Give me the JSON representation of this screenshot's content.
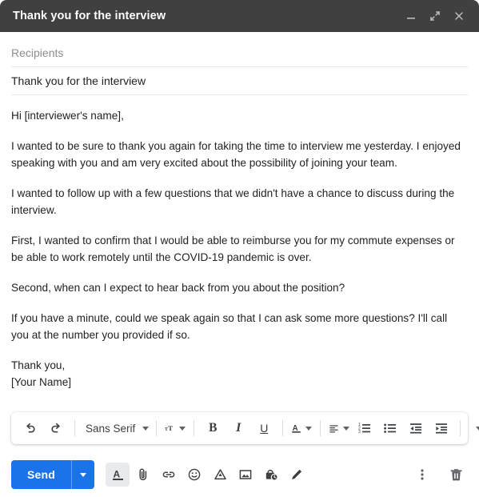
{
  "window": {
    "title": "Thank you for the interview",
    "header_color": "#404040",
    "controls": [
      {
        "name": "minimize",
        "label": "Minimize"
      },
      {
        "name": "expand",
        "label": "Full screen"
      },
      {
        "name": "close",
        "label": "Save & close"
      }
    ]
  },
  "fields": {
    "recipients_placeholder": "Recipients",
    "recipients_value": "",
    "subject_value": "Thank you for the interview"
  },
  "body": {
    "paragraphs": [
      "Hi [interviewer's name],",
      "I wanted to be sure to thank you again for taking the time to interview me yesterday. I enjoyed speaking with you and am very excited about the possibility of joining your team.",
      "I wanted to follow up with a few questions that we didn't have a chance to discuss during the interview.",
      "First, I wanted to confirm that I would be able to reimburse you for my commute expenses or be able to work remotely until the COVID-19 pandemic is over.",
      "Second, when can I expect to hear back from you about the position?",
      "If you have a minute, could we speak again so that I can ask some more questions? I'll call you at the number you provided if so."
    ],
    "signoff": "Thank you,",
    "signature": "[Your Name]"
  },
  "format_toolbar": {
    "undo_label": "Undo",
    "redo_label": "Redo",
    "font_family": "Sans Serif",
    "font_size_label": "Size",
    "bold_label": "B",
    "italic_label": "I",
    "underline_label": "U",
    "text_color_label": "A",
    "align_label": "Align",
    "numbered_list_label": "Numbered list",
    "bulleted_list_label": "Bulleted list",
    "indent_less_label": "Indent less",
    "indent_more_label": "Indent more",
    "more_label": "More formatting options"
  },
  "action_bar": {
    "send_label": "Send",
    "send_color": "#1a73e8",
    "send_options_label": "More send options",
    "formatting_label": "Formatting options",
    "attach_label": "Attach files",
    "link_label": "Insert link",
    "emoji_label": "Insert emoji",
    "drive_label": "Insert files using Drive",
    "photo_label": "Insert photo",
    "confidential_label": "Toggle confidential mode",
    "signature_label": "Insert signature",
    "more_options_label": "More options",
    "discard_label": "Discard draft"
  }
}
